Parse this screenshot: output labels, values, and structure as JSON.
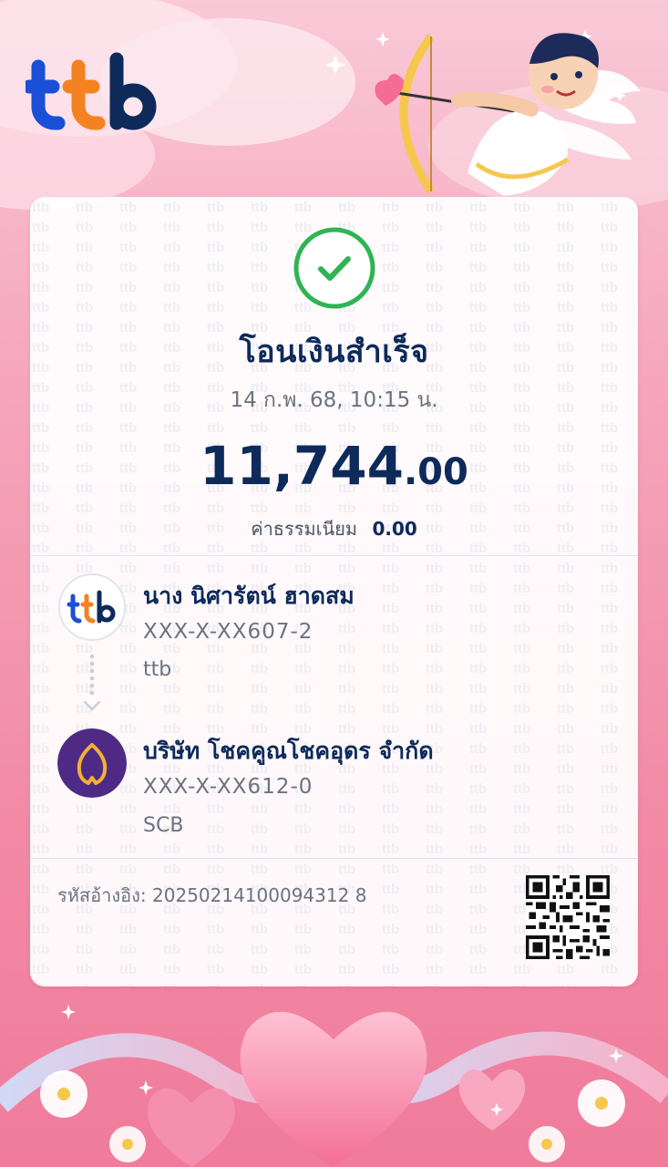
{
  "brand": {
    "logo_text": "ttb",
    "colors": {
      "primary": "#0d2a5b",
      "ttb_blue": "#1b4fd6",
      "ttb_orange": "#f58220",
      "success_green": "#2fb454",
      "scb_purple": "#4e2a84",
      "scb_gold": "#f2b134"
    }
  },
  "status": {
    "icon": "check-circle-icon",
    "title": "โอนเงินสำเร็จ",
    "datetime": "14 ก.พ. 68, 10:15 น."
  },
  "transfer": {
    "amount_integer": "11,744",
    "amount_decimal": ".00",
    "fee_label": "ค่าธรรมเนียม",
    "fee_value": "0.00"
  },
  "sender": {
    "name": "นาง นิศารัตน์ ฮาดสม",
    "account": "XXX-X-XX607-2",
    "bank": "ttb",
    "bank_logo": "ttb-logo-icon"
  },
  "receiver": {
    "name": "บริษัท โชคคูณโชคอุดร จำกัด",
    "account": "XXX-X-XX612-0",
    "bank": "SCB",
    "bank_logo": "scb-logo-icon"
  },
  "reference": {
    "label": "รหัสอ้างอิง: 20250214100094312 8"
  },
  "qr": {
    "icon": "qr-code-icon"
  }
}
